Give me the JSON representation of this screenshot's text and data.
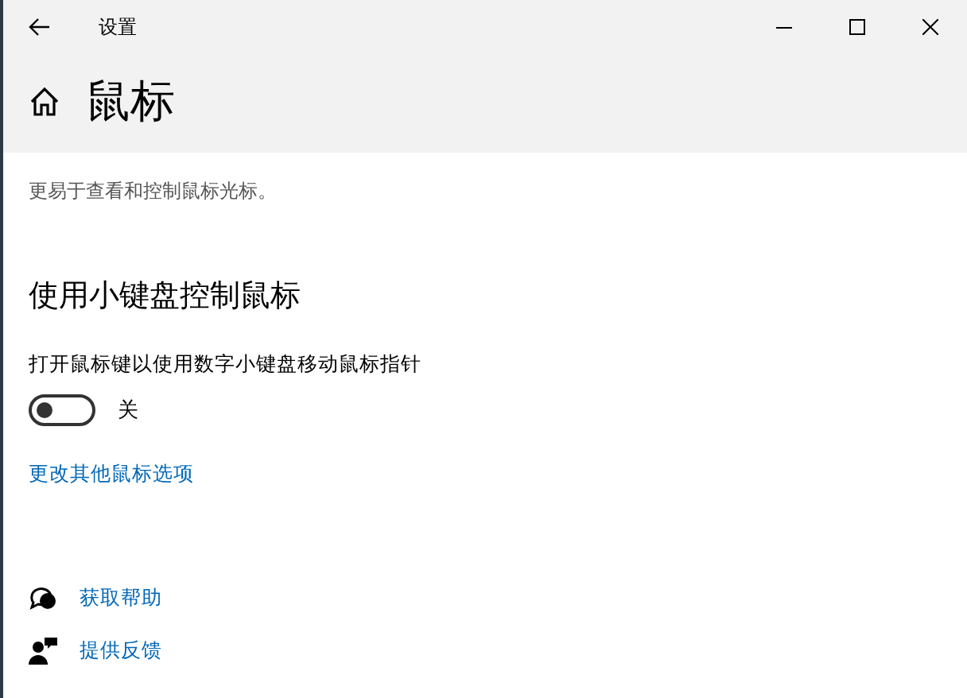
{
  "window": {
    "title": "设置"
  },
  "page": {
    "title": "鼠标",
    "description": "更易于查看和控制鼠标光标。"
  },
  "section": {
    "heading": "使用小键盘控制鼠标",
    "toggle_label": "打开鼠标键以使用数字小键盘移动鼠标指针",
    "toggle": {
      "on": false,
      "state_text": "关"
    },
    "link": "更改其他鼠标选项"
  },
  "help_links": [
    {
      "kind": "help",
      "label": "获取帮助"
    },
    {
      "kind": "feedback",
      "label": "提供反馈"
    }
  ]
}
